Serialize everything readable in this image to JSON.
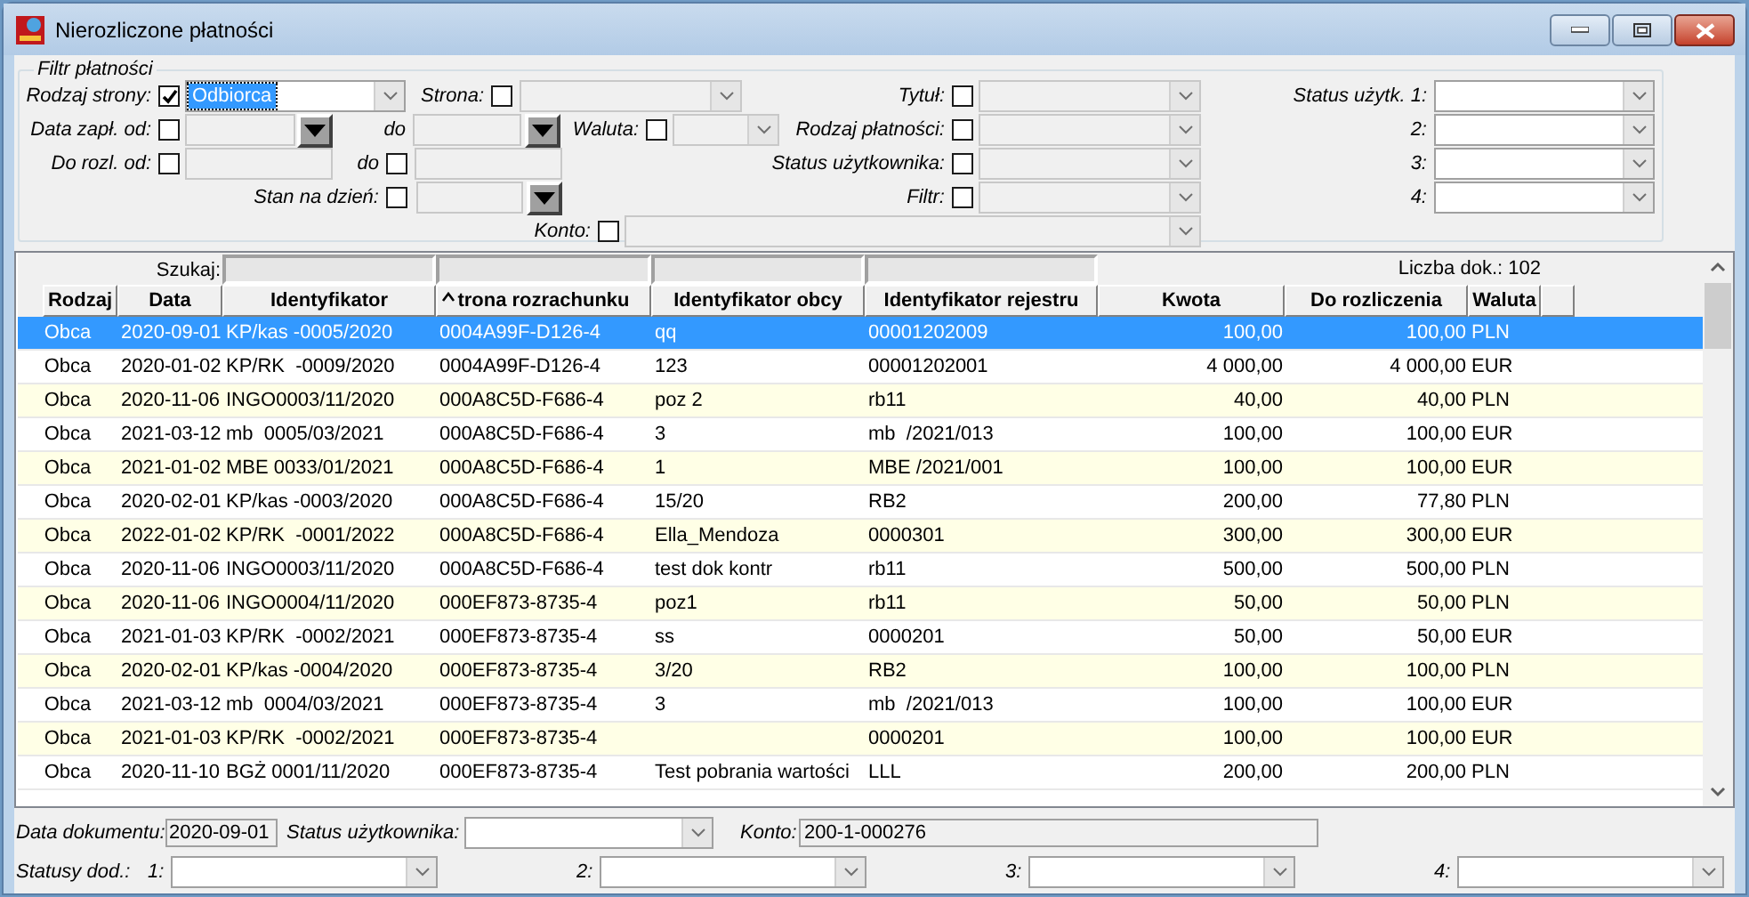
{
  "window": {
    "title": "Nierozliczone płatności"
  },
  "filter": {
    "title": "Filtr płatności",
    "rodzaj_strony": {
      "label": "Rodzaj strony:",
      "checked": true,
      "value": "Odbiorca"
    },
    "strona": {
      "label": "Strona:",
      "checked": false
    },
    "tytul": {
      "label": "Tytuł:",
      "checked": false
    },
    "data_zapl_od": {
      "label": "Data zapł. od:",
      "checked": false
    },
    "data_zapl_do": {
      "label": "do"
    },
    "waluta": {
      "label": "Waluta:",
      "checked": false
    },
    "rodzaj_platnosci": {
      "label": "Rodzaj płatności:",
      "checked": false
    },
    "do_rozl_od": {
      "label": "Do rozl. od:",
      "checked": false
    },
    "do_rozl_do": {
      "label": "do",
      "checked": false
    },
    "status_uzytkownika": {
      "label": "Status użytkownika:",
      "checked": false
    },
    "stan_na_dzien": {
      "label": "Stan na dzień:",
      "checked": false
    },
    "filtr": {
      "label": "Filtr:",
      "checked": false
    },
    "konto": {
      "label": "Konto:",
      "checked": false
    },
    "status_uzytk": [
      {
        "label": "Status użytk. 1:"
      },
      {
        "label": "2:"
      },
      {
        "label": "3:"
      },
      {
        "label": "4:"
      }
    ]
  },
  "grid": {
    "search_label": "Szukaj:",
    "count": "Liczba dok.: 102",
    "columns": [
      {
        "label": "Rodzaj",
        "sorted": false
      },
      {
        "label": "Data",
        "sorted": false
      },
      {
        "label": "Identyfikator",
        "sorted": false
      },
      {
        "label": "trona rozrachunku",
        "sorted": true
      },
      {
        "label": "Identyfikator obcy",
        "sorted": false
      },
      {
        "label": "Identyfikator rejestru",
        "sorted": false
      },
      {
        "label": "Kwota",
        "sorted": false
      },
      {
        "label": "Do rozliczenia",
        "sorted": false
      },
      {
        "label": "Waluta",
        "sorted": false
      }
    ],
    "rows": [
      {
        "selected": true,
        "cells": [
          "Obca",
          "2020-09-01",
          "KP/kas -0005/2020",
          "0004A99F-D126-4",
          "qq",
          "00001202009",
          "100,00",
          "100,00",
          "PLN"
        ]
      },
      {
        "selected": false,
        "cells": [
          "Obca",
          "2020-01-02",
          "KP/RK  -0009/2020",
          "0004A99F-D126-4",
          "123",
          "00001202001",
          "4 000,00",
          "4 000,00",
          "EUR"
        ]
      },
      {
        "selected": false,
        "cells": [
          "Obca",
          "2020-11-06",
          "INGO0003/11/2020",
          "000A8C5D-F686-4",
          "poz 2",
          "rb11",
          "40,00",
          "40,00",
          "PLN"
        ]
      },
      {
        "selected": false,
        "cells": [
          "Obca",
          "2021-03-12",
          "mb  0005/03/2021",
          "000A8C5D-F686-4",
          "3",
          "mb  /2021/013",
          "100,00",
          "100,00",
          "EUR"
        ]
      },
      {
        "selected": false,
        "cells": [
          "Obca",
          "2021-01-02",
          "MBE 0033/01/2021",
          "000A8C5D-F686-4",
          "1",
          "MBE /2021/001",
          "100,00",
          "100,00",
          "EUR"
        ]
      },
      {
        "selected": false,
        "cells": [
          "Obca",
          "2020-02-01",
          "KP/kas -0003/2020",
          "000A8C5D-F686-4",
          "15/20",
          "RB2",
          "200,00",
          "77,80",
          "PLN"
        ]
      },
      {
        "selected": false,
        "cells": [
          "Obca",
          "2022-01-02",
          "KP/RK  -0001/2022",
          "000A8C5D-F686-4",
          "Ella_Mendoza",
          "0000301",
          "300,00",
          "300,00",
          "EUR"
        ]
      },
      {
        "selected": false,
        "cells": [
          "Obca",
          "2020-11-06",
          "INGO0003/11/2020",
          "000A8C5D-F686-4",
          "test dok kontr",
          "rb11",
          "500,00",
          "500,00",
          "PLN"
        ]
      },
      {
        "selected": false,
        "cells": [
          "Obca",
          "2020-11-06",
          "INGO0004/11/2020",
          "000EF873-8735-4",
          "poz1",
          "rb11",
          "50,00",
          "50,00",
          "PLN"
        ]
      },
      {
        "selected": false,
        "cells": [
          "Obca",
          "2021-01-03",
          "KP/RK  -0002/2021",
          "000EF873-8735-4",
          "ss",
          "0000201",
          "50,00",
          "50,00",
          "EUR"
        ]
      },
      {
        "selected": false,
        "cells": [
          "Obca",
          "2020-02-01",
          "KP/kas -0004/2020",
          "000EF873-8735-4",
          "3/20",
          "RB2",
          "100,00",
          "100,00",
          "PLN"
        ]
      },
      {
        "selected": false,
        "cells": [
          "Obca",
          "2021-03-12",
          "mb  0004/03/2021",
          "000EF873-8735-4",
          "3",
          "mb  /2021/013",
          "100,00",
          "100,00",
          "EUR"
        ]
      },
      {
        "selected": false,
        "cells": [
          "Obca",
          "2021-01-03",
          "KP/RK  -0002/2021",
          "000EF873-8735-4",
          "",
          "0000201",
          "100,00",
          "100,00",
          "EUR"
        ]
      },
      {
        "selected": false,
        "cells": [
          "Obca",
          "2020-11-10",
          "BGŻ 0001/11/2020",
          "000EF873-8735-4",
          "Test pobrania wartości",
          "LLL",
          "200,00",
          "200,00",
          "PLN"
        ]
      }
    ]
  },
  "details": {
    "data_dokumentu": {
      "label": "Data dokumentu:",
      "value": "2020-09-01"
    },
    "status_uzytkownika": {
      "label": "Status użytkownika:"
    },
    "konto": {
      "label": "Konto:",
      "value": "200-1-000276"
    },
    "statusy_label": "Statusy dod.:",
    "statusy": [
      {
        "label": "1:"
      },
      {
        "label": "2:"
      },
      {
        "label": "3:"
      },
      {
        "label": "4:"
      }
    ]
  }
}
